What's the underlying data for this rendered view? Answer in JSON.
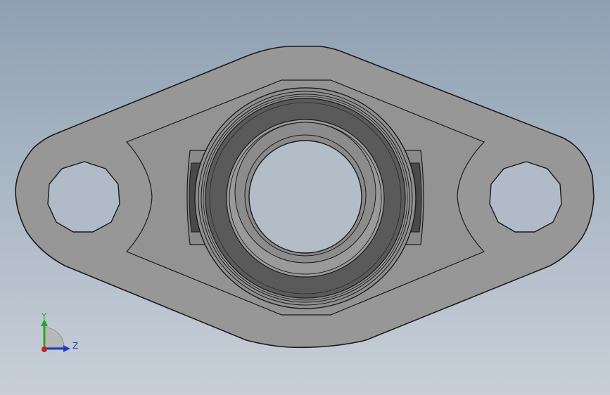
{
  "view": {
    "background_top": "#8ea0b3",
    "background_bottom": "#c8cfd8"
  },
  "model": {
    "part": "two-bolt-flange-bearing",
    "flange_color": "#979797",
    "housing_color": "#8f8f8f",
    "seal_color": "#5a5a5a",
    "inner_ring_color": "#9a9a9a",
    "edge_color": "#1a1a1a"
  },
  "triad": {
    "y_label": "Y",
    "z_label": "Z",
    "y_color": "#22aa22",
    "z_color": "#1f3fbf",
    "x_color": "#cc2222"
  }
}
